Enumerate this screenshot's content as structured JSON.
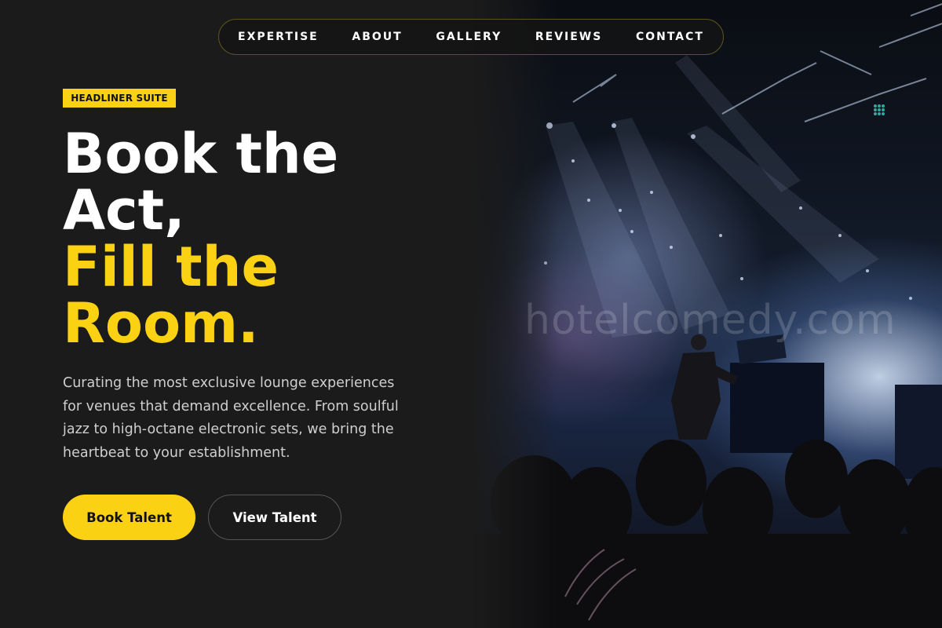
{
  "nav": {
    "items": [
      "EXPERTISE",
      "ABOUT",
      "GALLERY",
      "REVIEWS",
      "CONTACT"
    ]
  },
  "hero": {
    "badge": "HEADLINER SUITE",
    "headline_line1": "Book the",
    "headline_line2": "Act,",
    "headline_line3": "Fill the",
    "headline_line4": "Room.",
    "description": "Curating the most exclusive lounge experiences for venues that demand excellence. From soulful jazz to high-octane electronic sets, we bring the heartbeat to your establishment.",
    "primary_button": "Book Talent",
    "secondary_button": "View Talent",
    "image_watermark": "hotelcomedy.com"
  },
  "colors": {
    "accent": "#fbd213",
    "background": "#1b1b1b",
    "nav_border": "#5c5220"
  }
}
